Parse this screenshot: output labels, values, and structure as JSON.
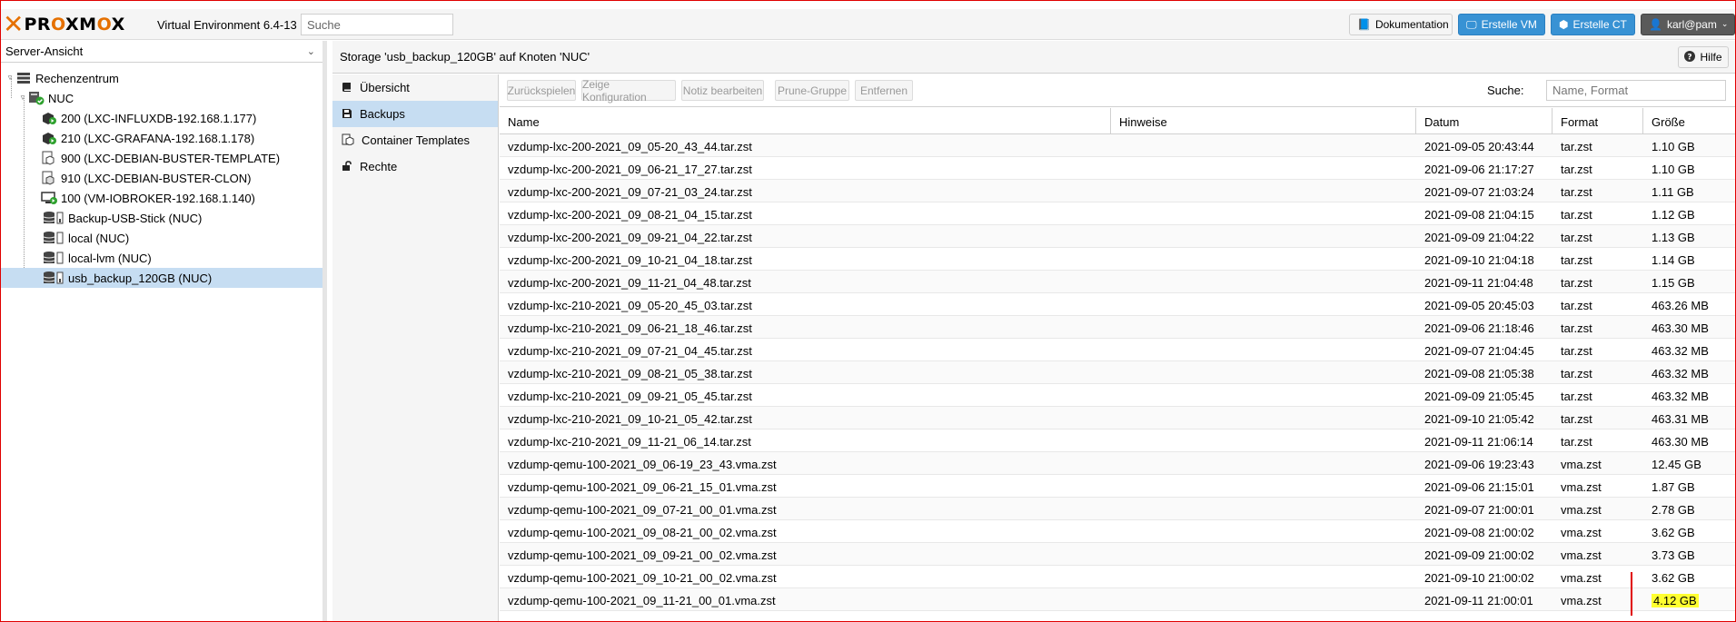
{
  "topbar": {
    "logo_text": "PROXMOX",
    "version": "Virtual Environment 6.4-13",
    "search_placeholder": "Suche",
    "doc_button": "Dokumentation",
    "create_vm_button": "Erstelle VM",
    "create_ct_button": "Erstelle CT",
    "user_button": "karl@pam"
  },
  "sidebar": {
    "view_selector": "Server-Ansicht",
    "tree": [
      {
        "label": "Rechenzentrum",
        "icon": "datacenter-icon"
      },
      {
        "label": "NUC",
        "icon": "node-icon"
      },
      {
        "label": "200 (LXC-INFLUXDB-192.168.1.177)",
        "icon": "container-running-icon"
      },
      {
        "label": "210 (LXC-GRAFANA-192.168.1.178)",
        "icon": "container-running-icon"
      },
      {
        "label": "900 (LXC-DEBIAN-BUSTER-TEMPLATE)",
        "icon": "template-icon"
      },
      {
        "label": "910 (LXC-DEBIAN-BUSTER-CLON)",
        "icon": "container-stopped-icon"
      },
      {
        "label": "100 (VM-IOBROKER-192.168.1.140)",
        "icon": "vm-running-icon"
      },
      {
        "label": "Backup-USB-Stick (NUC)",
        "icon": "storage-icon"
      },
      {
        "label": "local (NUC)",
        "icon": "storage-icon"
      },
      {
        "label": "local-lvm (NUC)",
        "icon": "storage-icon"
      },
      {
        "label": "usb_backup_120GB (NUC)",
        "icon": "storage-icon"
      }
    ]
  },
  "header": {
    "title": "Storage 'usb_backup_120GB' auf Knoten 'NUC'",
    "help_button": "Hilfe"
  },
  "nav": [
    {
      "label": "Übersicht",
      "icon": "book-icon"
    },
    {
      "label": "Backups",
      "icon": "floppy-icon"
    },
    {
      "label": "Container Templates",
      "icon": "template-icon"
    },
    {
      "label": "Rechte",
      "icon": "unlock-icon"
    }
  ],
  "toolbar": {
    "restore": "Zurückspielen",
    "show_config": "Zeige Konfiguration",
    "edit_note": "Notiz bearbeiten",
    "prune_group": "Prune-Gruppe",
    "remove": "Entfernen",
    "search_label": "Suche:",
    "search_placeholder": "Name, Format"
  },
  "table": {
    "columns": [
      "Name",
      "Hinweise",
      "Datum",
      "Format",
      "Größe"
    ],
    "rows": [
      [
        "vzdump-lxc-200-2021_09_05-20_43_44.tar.zst",
        "",
        "2021-09-05 20:43:44",
        "tar.zst",
        "1.10 GB"
      ],
      [
        "vzdump-lxc-200-2021_09_06-21_17_27.tar.zst",
        "",
        "2021-09-06 21:17:27",
        "tar.zst",
        "1.10 GB"
      ],
      [
        "vzdump-lxc-200-2021_09_07-21_03_24.tar.zst",
        "",
        "2021-09-07 21:03:24",
        "tar.zst",
        "1.11 GB"
      ],
      [
        "vzdump-lxc-200-2021_09_08-21_04_15.tar.zst",
        "",
        "2021-09-08 21:04:15",
        "tar.zst",
        "1.12 GB"
      ],
      [
        "vzdump-lxc-200-2021_09_09-21_04_22.tar.zst",
        "",
        "2021-09-09 21:04:22",
        "tar.zst",
        "1.13 GB"
      ],
      [
        "vzdump-lxc-200-2021_09_10-21_04_18.tar.zst",
        "",
        "2021-09-10 21:04:18",
        "tar.zst",
        "1.14 GB"
      ],
      [
        "vzdump-lxc-200-2021_09_11-21_04_48.tar.zst",
        "",
        "2021-09-11 21:04:48",
        "tar.zst",
        "1.15 GB"
      ],
      [
        "vzdump-lxc-210-2021_09_05-20_45_03.tar.zst",
        "",
        "2021-09-05 20:45:03",
        "tar.zst",
        "463.26 MB"
      ],
      [
        "vzdump-lxc-210-2021_09_06-21_18_46.tar.zst",
        "",
        "2021-09-06 21:18:46",
        "tar.zst",
        "463.30 MB"
      ],
      [
        "vzdump-lxc-210-2021_09_07-21_04_45.tar.zst",
        "",
        "2021-09-07 21:04:45",
        "tar.zst",
        "463.32 MB"
      ],
      [
        "vzdump-lxc-210-2021_09_08-21_05_38.tar.zst",
        "",
        "2021-09-08 21:05:38",
        "tar.zst",
        "463.32 MB"
      ],
      [
        "vzdump-lxc-210-2021_09_09-21_05_45.tar.zst",
        "",
        "2021-09-09 21:05:45",
        "tar.zst",
        "463.32 MB"
      ],
      [
        "vzdump-lxc-210-2021_09_10-21_05_42.tar.zst",
        "",
        "2021-09-10 21:05:42",
        "tar.zst",
        "463.31 MB"
      ],
      [
        "vzdump-lxc-210-2021_09_11-21_06_14.tar.zst",
        "",
        "2021-09-11 21:06:14",
        "tar.zst",
        "463.30 MB"
      ],
      [
        "vzdump-qemu-100-2021_09_06-19_23_43.vma.zst",
        "",
        "2021-09-06 19:23:43",
        "vma.zst",
        "12.45 GB"
      ],
      [
        "vzdump-qemu-100-2021_09_06-21_15_01.vma.zst",
        "",
        "2021-09-06 21:15:01",
        "vma.zst",
        "1.87 GB"
      ],
      [
        "vzdump-qemu-100-2021_09_07-21_00_01.vma.zst",
        "",
        "2021-09-07 21:00:01",
        "vma.zst",
        "2.78 GB"
      ],
      [
        "vzdump-qemu-100-2021_09_08-21_00_02.vma.zst",
        "",
        "2021-09-08 21:00:02",
        "vma.zst",
        "3.62 GB"
      ],
      [
        "vzdump-qemu-100-2021_09_09-21_00_02.vma.zst",
        "",
        "2021-09-09 21:00:02",
        "vma.zst",
        "3.73 GB"
      ],
      [
        "vzdump-qemu-100-2021_09_10-21_00_02.vma.zst",
        "",
        "2021-09-10 21:00:02",
        "vma.zst",
        "3.62 GB"
      ],
      [
        "vzdump-qemu-100-2021_09_11-21_00_01.vma.zst",
        "",
        "2021-09-11 21:00:01",
        "vma.zst",
        "4.12 GB"
      ]
    ],
    "highlighted_row": 20
  },
  "colors": {
    "accent": "#3892d4",
    "brand": "#e57000",
    "selection": "#c6ddf2",
    "highlight": "#ffff30",
    "annotation": "#e00000"
  }
}
